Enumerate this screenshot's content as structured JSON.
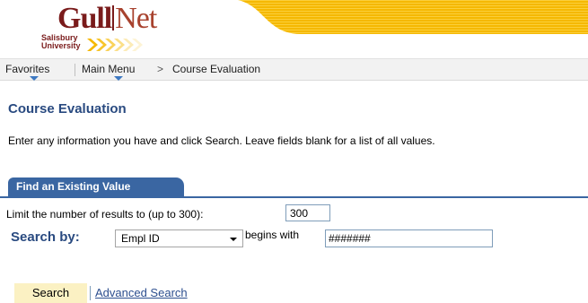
{
  "logo": {
    "gull": "Gull",
    "net": "Net",
    "line1": "Salisbury",
    "line2": "University",
    "colors": {
      "maroon": "#7a1b1b",
      "gold": "#f5b800"
    }
  },
  "nav": {
    "favorites": "Favorites",
    "main_menu": "Main Menu",
    "separator": ">",
    "crumb": "Course Evaluation"
  },
  "page": {
    "title": "Course Evaluation",
    "instructions": "Enter any information you have and click Search. Leave fields blank for a list of all values."
  },
  "tab": {
    "label": "Find an Existing Value"
  },
  "form": {
    "limit_label": "Limit the number of results to (up to 300):",
    "limit_value": "300",
    "search_by_label": "Search by:",
    "field_selected": "Empl ID",
    "operator_label": "begins with",
    "search_value": "#######"
  },
  "actions": {
    "search": "Search",
    "advanced_search": "Advanced Search"
  },
  "colors": {
    "accent": "#294a80",
    "tab": "#3a66a2",
    "button_bg": "#fbf1c3"
  }
}
